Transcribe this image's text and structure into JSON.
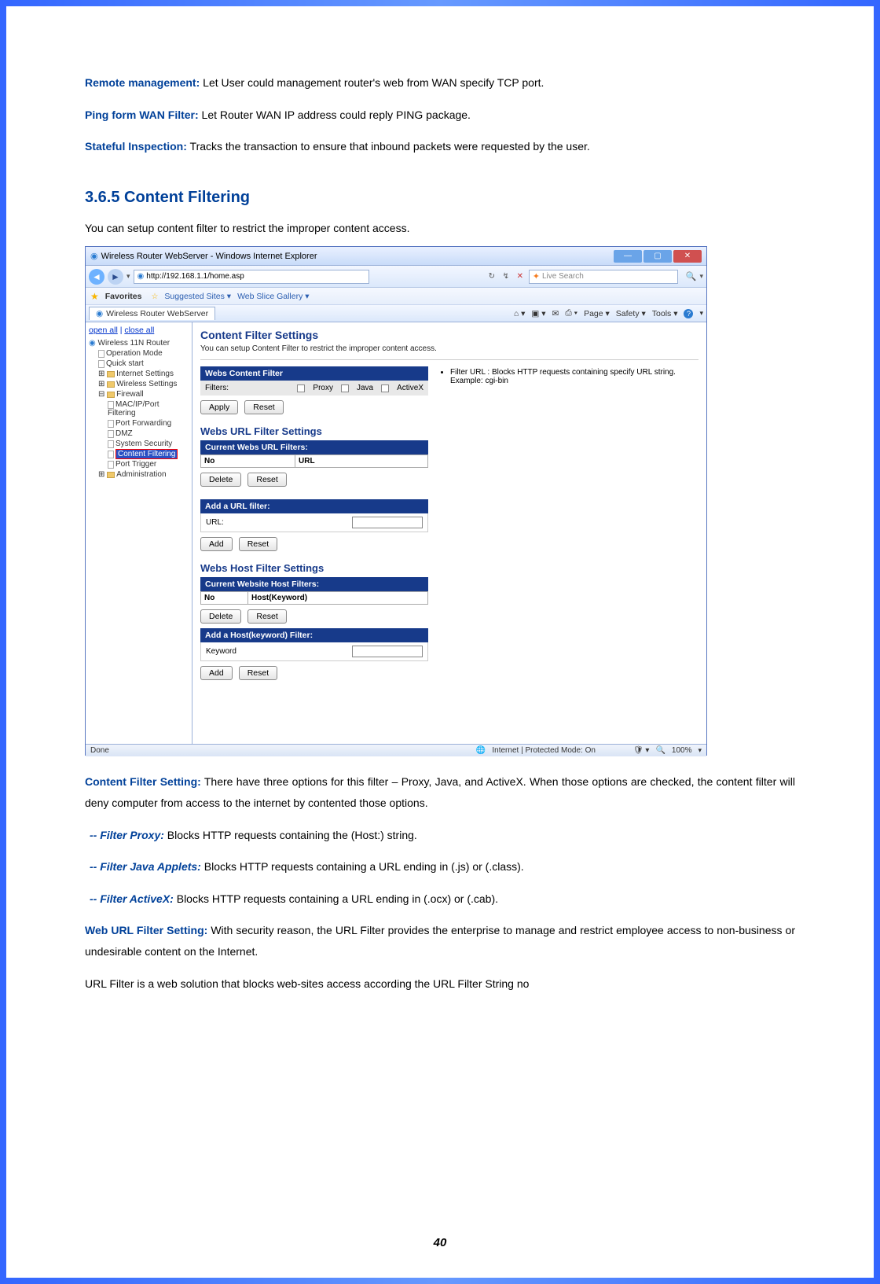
{
  "definitions": {
    "remote_management_label": "Remote management:",
    "remote_management_text": " Let User could management router's web from WAN specify TCP port.",
    "ping_filter_label": "Ping form WAN Filter:",
    "ping_filter_text": " Let Router WAN IP address could reply PING package.",
    "stateful_label": "Stateful Inspection:",
    "stateful_text": " Tracks the transaction to ensure that inbound packets were requested by the user."
  },
  "section": {
    "number_title": "3.6.5   Content Filtering",
    "intro": "You can setup content filter to restrict the improper content access."
  },
  "ie": {
    "window_title": "Wireless Router WebServer - Windows Internet Explorer",
    "url": "http://192.168.1.1/home.asp",
    "search_placeholder": "Live Search",
    "fav_label": "Favorites",
    "suggested": "Suggested Sites ▾",
    "webslice": "Web Slice Gallery ▾",
    "tab_title": "Wireless Router WebServer",
    "tools": {
      "page": "Page ▾",
      "safety": "Safety ▾",
      "tools": "Tools ▾"
    },
    "status_done": "Done",
    "status_mode": "Internet | Protected Mode: On",
    "status_zoom": "100%"
  },
  "tree": {
    "open_all": "open all",
    "close_all": "close all",
    "root": "Wireless 11N Router",
    "items": [
      "Operation Mode",
      "Quick start",
      "Internet Settings",
      "Wireless Settings",
      "Firewall",
      "MAC/IP/Port Filtering",
      "Port Forwarding",
      "DMZ",
      "System Security",
      "Content Filtering",
      "Port Trigger",
      "Administration"
    ]
  },
  "cf": {
    "title": "Content Filter Settings",
    "intro": "You can setup Content Filter to restrict the improper content access.",
    "box1_header": "Webs Content Filter",
    "filters_label": "Filters:",
    "opt_proxy": "Proxy",
    "opt_java": "Java",
    "opt_activex": "ActiveX",
    "hint_header": "Filter URL : Blocks HTTP requests containing specify URL string. Example: cgi-bin",
    "apply": "Apply",
    "reset": "Reset",
    "url_title": "Webs URL Filter Settings",
    "url_box_header": "Current Webs URL Filters:",
    "col_no": "No",
    "col_url": "URL",
    "delete": "Delete",
    "add_url_header": "Add a URL filter:",
    "url_label": "URL:",
    "add": "Add",
    "host_title": "Webs Host Filter Settings",
    "host_box_header": "Current Website Host Filters:",
    "col_hostkw": "Host(Keyword)",
    "add_host_header": "Add a Host(keyword) Filter:",
    "keyword_label": "Keyword"
  },
  "post": {
    "cfs_label": "Content Filter Setting:",
    "cfs_text": " There have three options for this filter – Proxy, Java, and ActiveX. When those options are checked, the content filter will deny computer from access to the internet by contented those options.",
    "proxy_label": "-- Filter Proxy:",
    "proxy_text": " Blocks HTTP requests containing the (Host:) string.",
    "java_label": "-- Filter Java Applets:",
    "java_text": " Blocks HTTP requests containing a URL ending in (.js) or (.class).",
    "activex_label": "-- Filter ActiveX:",
    "activex_text": " Blocks HTTP requests containing a URL ending in (.ocx) or (.cab).",
    "wufs_label": "Web URL Filter Setting:",
    "wufs_text": " With security reason, the URL Filter provides the enterprise to manage and restrict employee access to non-business or undesirable content on the Internet.",
    "wufs_line2": "URL Filter is a web solution that blocks web-sites access according the URL Filter String no"
  },
  "page_number": "40"
}
